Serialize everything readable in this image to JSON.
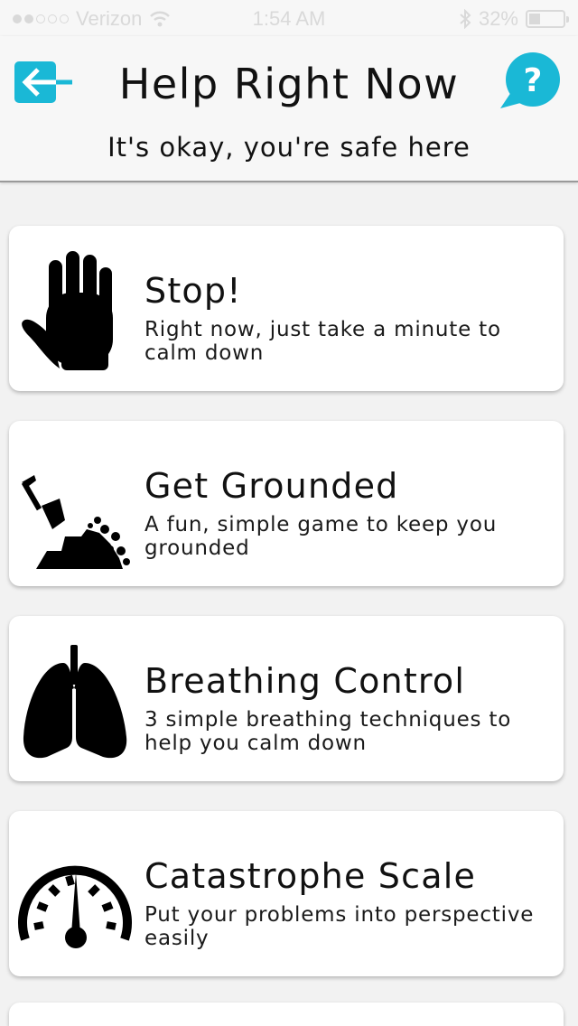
{
  "status_bar": {
    "carrier": "Verizon",
    "time": "1:54 AM",
    "battery_percent_label": "32%",
    "battery_level": 0.32
  },
  "header": {
    "title": "Help Right Now",
    "subtitle": "It's okay, you're safe here"
  },
  "colors": {
    "accent": "#1ab8d6",
    "background": "#f2f2f2",
    "card": "#ffffff"
  },
  "cards": [
    {
      "icon": "hand-icon",
      "title": "Stop!",
      "description": "Right now, just take a minute to calm down"
    },
    {
      "icon": "shovel-icon",
      "title": "Get Grounded",
      "description": "A fun, simple game to keep you grounded"
    },
    {
      "icon": "lungs-icon",
      "title": "Breathing Control",
      "description": "3 simple breathing techniques to help you calm down"
    },
    {
      "icon": "gauge-icon",
      "title": "Catastrophe Scale",
      "description": "Put your problems into perspective easily"
    }
  ]
}
